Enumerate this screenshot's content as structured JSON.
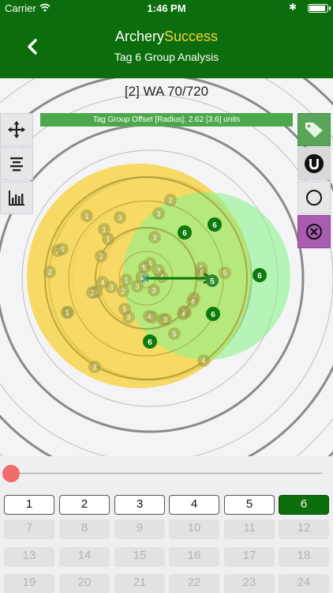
{
  "status": {
    "carrier": "Carrier",
    "time": "1:46 PM"
  },
  "nav": {
    "title_part1": "Archery",
    "title_part2": "Success",
    "subtitle": "Tag 6 Group Analysis"
  },
  "round": {
    "title": "[2] WA 70/720"
  },
  "offset_banner": "Tag Group Offset [Radius]: 2.62 [3.6] units",
  "colors": {
    "header": "#0c6d0c",
    "yellow_group": "#f7d44b",
    "green_group": "#8cf28c",
    "tag6_arrow": "#0c7a0c",
    "other_arrow": "#9d9a40"
  },
  "arrows": {
    "other": [
      {
        "label": "1"
      },
      {
        "label": "3"
      },
      {
        "label": "2"
      },
      {
        "label": "3"
      },
      {
        "label": "1"
      },
      {
        "label": "1"
      },
      {
        "label": "2"
      },
      {
        "label": "5"
      },
      {
        "label": "2"
      },
      {
        "label": "3"
      },
      {
        "label": "2"
      },
      {
        "label": "1"
      },
      {
        "label": "4"
      },
      {
        "label": "5"
      },
      {
        "label": "3"
      },
      {
        "label": "1"
      },
      {
        "label": "4"
      },
      {
        "label": "3"
      },
      {
        "label": "4"
      },
      {
        "label": "3"
      },
      {
        "label": "3"
      },
      {
        "label": "2"
      },
      {
        "label": "2"
      },
      {
        "label": "3"
      },
      {
        "label": "1"
      },
      {
        "label": "2"
      },
      {
        "label": "5"
      },
      {
        "label": "2"
      },
      {
        "label": "4"
      },
      {
        "label": "5"
      },
      {
        "label": "4"
      },
      {
        "label": "3"
      },
      {
        "label": "5"
      },
      {
        "label": "3"
      },
      {
        "label": "4"
      },
      {
        "label": "5"
      },
      {
        "label": "4"
      },
      {
        "label": "1"
      },
      {
        "label": "3"
      },
      {
        "label": "4"
      },
      {
        "label": "3"
      },
      {
        "label": "4"
      },
      {
        "label": "3"
      },
      {
        "label": "5"
      }
    ],
    "tag6": [
      {
        "label": "6"
      },
      {
        "label": "6"
      },
      {
        "label": "6"
      },
      {
        "label": "6"
      },
      {
        "label": "6"
      },
      {
        "label": "5"
      }
    ]
  },
  "tags": {
    "row1": [
      "1",
      "2",
      "3",
      "4",
      "5",
      "6"
    ],
    "row2": [
      "7",
      "8",
      "9",
      "10",
      "11",
      "12"
    ],
    "row3": [
      "13",
      "14",
      "15",
      "16",
      "17",
      "18"
    ],
    "row4": [
      "19",
      "20",
      "21",
      "22",
      "23",
      "24"
    ],
    "selected": "6"
  }
}
